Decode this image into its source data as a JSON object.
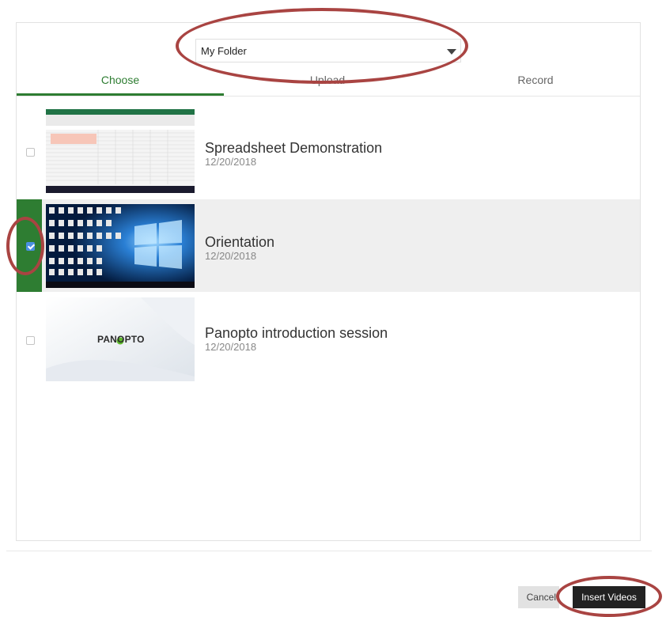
{
  "folder_select": {
    "value": "My Folder",
    "caret_icon": "caret-down-icon"
  },
  "tabs": [
    {
      "label": "Choose",
      "active": true
    },
    {
      "label": "Upload",
      "active": false
    },
    {
      "label": "Record",
      "active": false
    }
  ],
  "videos": [
    {
      "title": "Spreadsheet Demonstration",
      "date": "12/20/2018",
      "checked": false
    },
    {
      "title": "Orientation",
      "date": "12/20/2018",
      "checked": true
    },
    {
      "title": "Panopto introduction session",
      "date": "12/20/2018",
      "checked": false
    }
  ],
  "thumbnails": {
    "panopto_logo": "PANOPTO"
  },
  "footer": {
    "cancel_label": "Cancel",
    "insert_label": "Insert Videos"
  },
  "colors": {
    "accent": "#2e7d32",
    "annotation": "#a94442",
    "checkbox_checked": "#4a90e2"
  }
}
